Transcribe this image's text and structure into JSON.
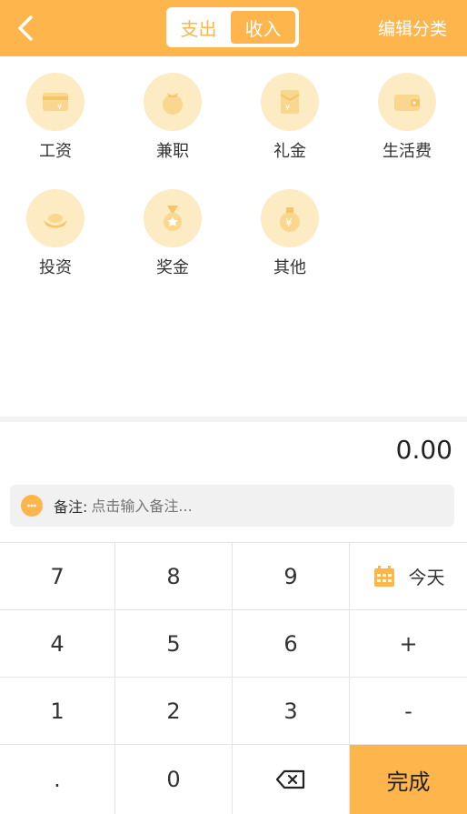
{
  "header": {
    "tabs": [
      {
        "label": "支出",
        "active": false
      },
      {
        "label": "收入",
        "active": true
      }
    ],
    "edit_label": "编辑分类",
    "back_icon": "chevron-left-icon",
    "bg_color": "#FDB54C"
  },
  "categories": [
    {
      "label": "工资",
      "icon": "wallet-card-icon"
    },
    {
      "label": "兼职",
      "icon": "moneybag-icon"
    },
    {
      "label": "礼金",
      "icon": "red-envelope-icon"
    },
    {
      "label": "生活费",
      "icon": "purse-icon"
    },
    {
      "label": "投资",
      "icon": "gold-ingot-icon"
    },
    {
      "label": "奖金",
      "icon": "medal-icon"
    },
    {
      "label": "其他",
      "icon": "yuan-bag-icon"
    }
  ],
  "amount": "0.00",
  "note": {
    "label": "备注:",
    "placeholder": "点击输入备注..."
  },
  "keypad": {
    "keys": [
      "7",
      "8",
      "9",
      "4",
      "5",
      "6",
      "1",
      "2",
      "3",
      ".",
      "0"
    ],
    "today_label": "今天",
    "plus_label": "+",
    "minus_label": "-",
    "done_label": "完成"
  }
}
